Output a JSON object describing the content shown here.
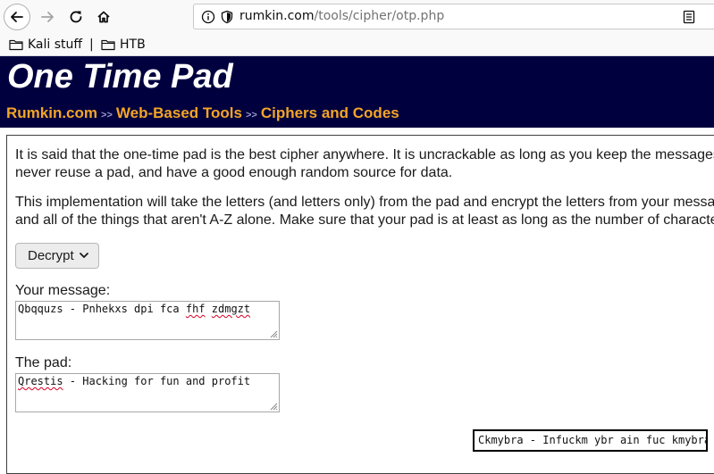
{
  "browser": {
    "url_host": "rumkin.com",
    "url_path": "/tools/cipher/otp.php",
    "bookmarks": [
      {
        "label": "Kali stuff",
        "icon": "folder-icon"
      },
      {
        "label": "HTB",
        "icon": "folder-icon"
      }
    ],
    "bookmark_separator": "|"
  },
  "header": {
    "title": "One Time Pad",
    "breadcrumbs": [
      "Rumkin.com",
      "Web-Based Tools",
      "Ciphers and Codes"
    ],
    "breadcrumb_separator": ">>"
  },
  "content": {
    "para1_line1": "It is said that the one-time pad is the best cipher anywhere. It is uncrackable as long as you keep the messages",
    "para1_line2": "never reuse a pad, and have a good enough random source for data.",
    "para2_line1": "This implementation will take the letters (and letters only) from the pad and encrypt the letters from your messag",
    "para2_line2": "and all of the things that aren't A-Z alone. Make sure that your pad is at least as long as the number of character",
    "mode_selected": "Decrypt",
    "message_label": "Your message:",
    "message_value_pre": "Qbqquzs - Pnhekxs dpi fca ",
    "message_value_err1": "fhf",
    "message_value_sp": " ",
    "message_value_err2": "zdmgzt",
    "pad_label": "The pad:",
    "pad_value_err": "Qrestis",
    "pad_value_post": " - Hacking for fun and profit",
    "result": "Ckmybra - Infuckm ybr ain fuc kmybra"
  },
  "colors": {
    "header_bg": "#00003f",
    "title": "#ffffff",
    "breadcrumb": "#f3a526",
    "spellcheck": "#d70022"
  }
}
